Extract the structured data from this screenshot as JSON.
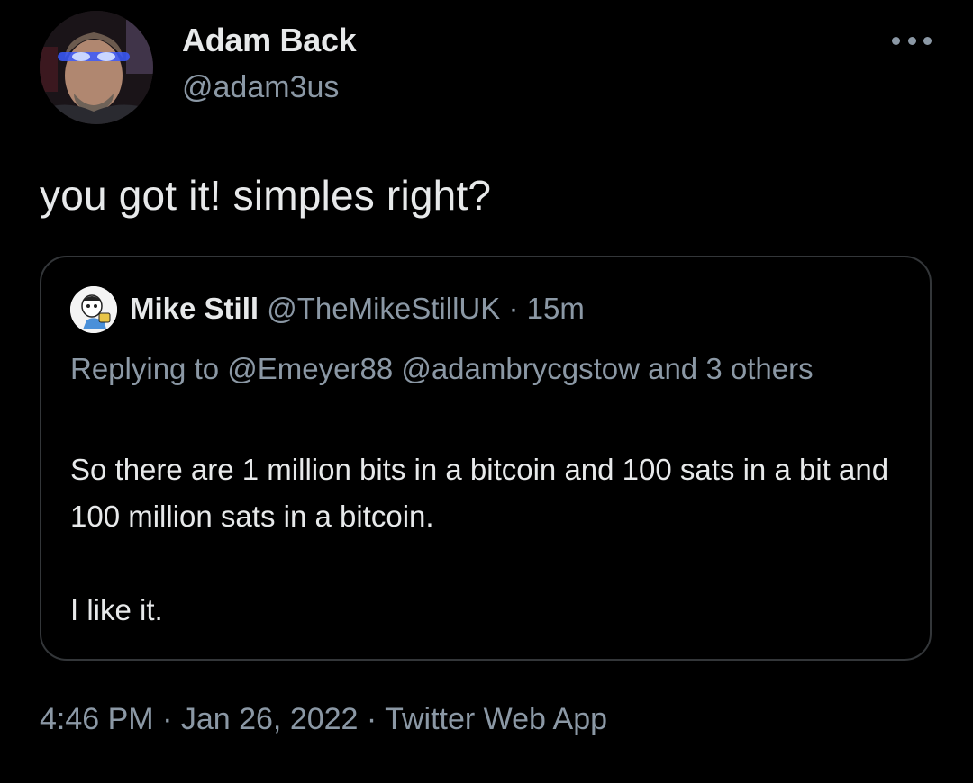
{
  "author": {
    "name": "Adam Back",
    "handle": "@adam3us",
    "avatar_icon": "profile-photo-icon"
  },
  "menu": {
    "more_icon": "more-horizontal-icon"
  },
  "tweet": {
    "text": "you got it! simples right?"
  },
  "quoted_tweet": {
    "name": "Mike Still",
    "handle": "@TheMikeStillUK",
    "separator": " · ",
    "time": "15m",
    "replying_to": "Replying to @Emeyer88 @adambrycgstow and 3 others",
    "body_line_1": "So there are 1 million bits in a bitcoin and 100 sats in a bit and 100 million sats in a bitcoin.",
    "body_line_2": "I like it."
  },
  "footer": {
    "time": "4:46 PM",
    "separator_1": " · ",
    "date": "Jan 26, 2022",
    "separator_2": " · ",
    "source": "Twitter Web App"
  },
  "colors": {
    "background": "#000000",
    "primary_text": "#e7e9ea",
    "secondary_text": "#8b98a5",
    "border": "#333639"
  }
}
